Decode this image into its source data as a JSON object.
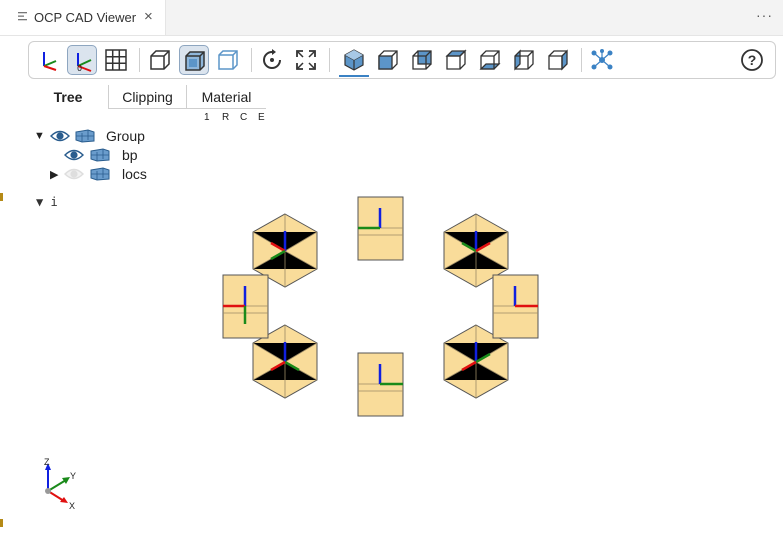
{
  "tab": {
    "title": "OCP CAD Viewer",
    "close": "×",
    "more": "···"
  },
  "toolbar": {
    "buttons": [
      "axes-icon",
      "axes-zero-icon",
      "grid-icon",
      "perspective-icon",
      "transparent-icon",
      "black-edges-icon",
      "reset-icon",
      "fit-icon",
      "iso-view-icon",
      "front-view-icon",
      "rear-view-icon",
      "top-view-icon",
      "bottom-view-icon",
      "left-view-icon",
      "right-view-icon",
      "explode-icon",
      "help-icon"
    ],
    "help_label": "?"
  },
  "control_tabs": [
    "Tree",
    "Clipping",
    "Material"
  ],
  "tree_header": [
    "1",
    "R",
    "C",
    "E"
  ],
  "tree": [
    {
      "label": "Group",
      "expanded": true,
      "visible": true
    },
    {
      "label": "bp",
      "visible": true
    },
    {
      "label": "locs",
      "expanded": false,
      "visible": false
    }
  ],
  "info": {
    "toggle": "▼",
    "label": "i"
  },
  "axes_labels": {
    "z": "Z",
    "y": "Y",
    "x": "X"
  },
  "colors": {
    "face": "#f9dc9a",
    "edge": "#555555",
    "accent": "#3b82c4",
    "axis_x": "#e01010",
    "axis_y": "#1a8a1a",
    "axis_z": "#1020e0"
  }
}
